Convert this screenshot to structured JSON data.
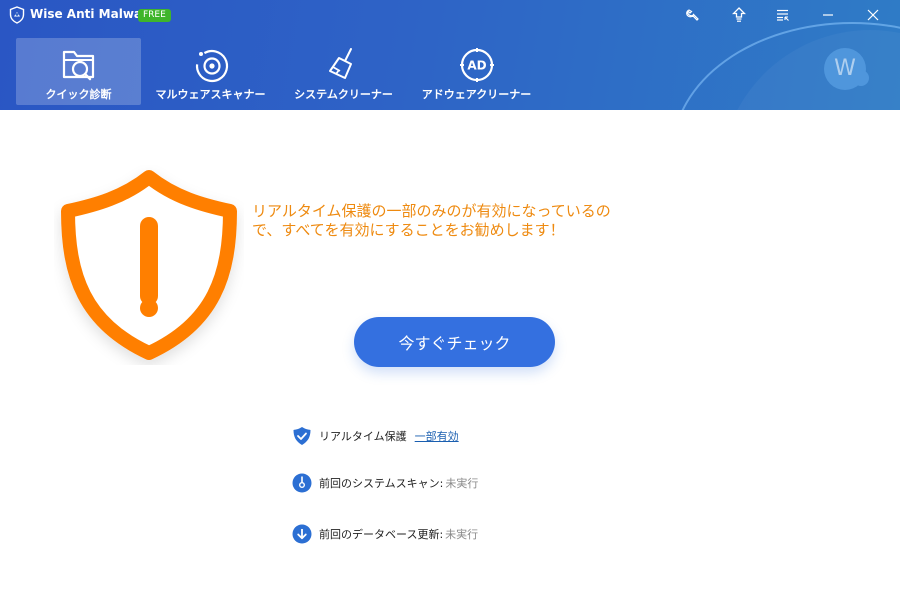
{
  "app": {
    "title": "Wise Anti Malware",
    "badge": "FREE"
  },
  "window_controls": [
    {
      "name": "tools-icon"
    },
    {
      "name": "upgrade-icon"
    },
    {
      "name": "menu-icon"
    },
    {
      "name": "minimize-icon"
    },
    {
      "name": "close-icon"
    }
  ],
  "nav": {
    "tabs": [
      {
        "label": "クイック診断",
        "icon": "folder-search-icon",
        "active": true
      },
      {
        "label": "マルウェアスキャナー",
        "icon": "scanner-icon",
        "active": false
      },
      {
        "label": "システムクリーナー",
        "icon": "broom-icon",
        "active": false
      },
      {
        "label": "アドウェアクリーナー",
        "icon": "ad-target-icon",
        "active": false
      }
    ]
  },
  "user": {
    "avatar_letter": "W"
  },
  "main": {
    "warning_line1": "リアルタイム保護の一部のみのが有効になっているの",
    "warning_line2": "で、すべてを有効にすることをお勧めします！",
    "check_button": "今すぐチェック",
    "status": [
      {
        "label": "リアルタイム保護",
        "value": "一部有効",
        "is_link": true,
        "icon": "shield-check-icon"
      },
      {
        "label": "前回のシステムスキャン:",
        "value": "未実行",
        "is_link": false,
        "icon": "scan-gauge-icon"
      },
      {
        "label": "前回のデータベース更新:",
        "value": "未実行",
        "is_link": false,
        "icon": "download-icon"
      }
    ]
  },
  "colors": {
    "header_blue": "#2e63c6",
    "accent_blue": "#3470e0",
    "warning_orange": "#ff7f00",
    "warning_text": "#ee8a10",
    "free_badge": "#3fb52a",
    "link": "#1a5fb0"
  }
}
